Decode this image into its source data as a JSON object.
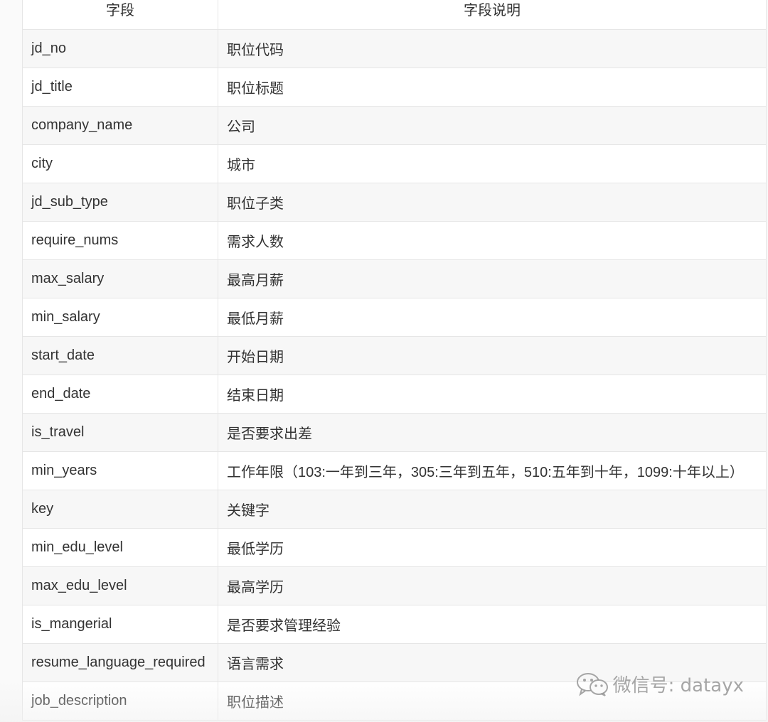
{
  "table": {
    "headers": [
      "字段",
      "字段说明"
    ],
    "rows": [
      {
        "field": "jd_no",
        "desc": "职位代码"
      },
      {
        "field": "jd_title",
        "desc": "职位标题"
      },
      {
        "field": "company_name",
        "desc": "公司"
      },
      {
        "field": "city",
        "desc": "城市"
      },
      {
        "field": "jd_sub_type",
        "desc": "职位子类"
      },
      {
        "field": "require_nums",
        "desc": "需求人数"
      },
      {
        "field": "max_salary",
        "desc": "最高月薪"
      },
      {
        "field": "min_salary",
        "desc": "最低月薪"
      },
      {
        "field": "start_date",
        "desc": "开始日期"
      },
      {
        "field": "end_date",
        "desc": "结束日期"
      },
      {
        "field": "is_travel",
        "desc": "是否要求出差"
      },
      {
        "field": "min_years",
        "desc": "工作年限（103:一年到三年，305:三年到五年，510:五年到十年，1099:十年以上）"
      },
      {
        "field": "key",
        "desc": "关键字"
      },
      {
        "field": "min_edu_level",
        "desc": "最低学历"
      },
      {
        "field": "max_edu_level",
        "desc": "最高学历"
      },
      {
        "field": "is_mangerial",
        "desc": "是否要求管理经验"
      },
      {
        "field": "resume_language_required",
        "desc": "语言需求"
      },
      {
        "field": "job_description",
        "desc": "职位描述"
      }
    ]
  },
  "watermark": {
    "text": "微信号: datayx",
    "icon": "wechat-icon"
  }
}
